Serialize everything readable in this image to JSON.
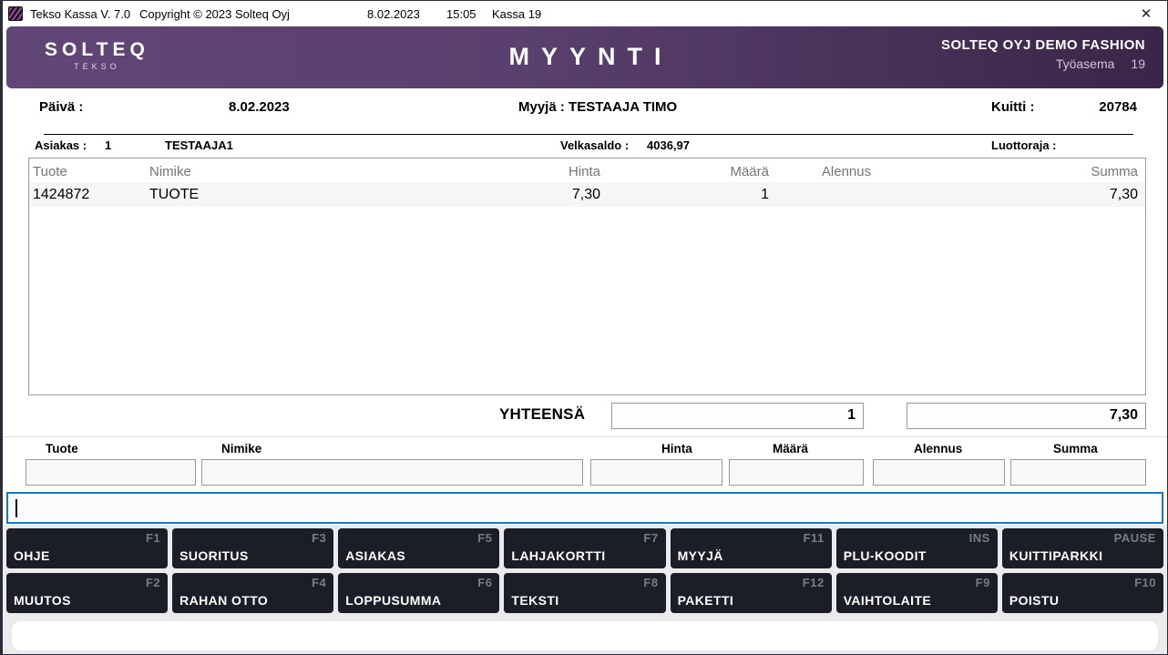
{
  "titlebar": {
    "title": "Tekso Kassa V. 7.0",
    "copyright": "Copyright © 2023 Solteq Oyj",
    "date": "8.02.2023",
    "time": "15:05",
    "register": "Kassa 19",
    "close_glyph": "✕"
  },
  "header": {
    "logo_primary": "SOLTEQ",
    "logo_secondary": "TEKSO",
    "screen_title": "MYYNTI",
    "store_name": "SOLTEQ OYJ DEMO FASHION",
    "workstation_label": "Työasema",
    "workstation_number": "19"
  },
  "receipt_info": {
    "date_label": "Päivä :",
    "date_value": "8.02.2023",
    "seller_label": "Myyjä :",
    "seller_value": "TESTAAJA TIMO",
    "receipt_label": "Kuitti :",
    "receipt_number": "20784"
  },
  "customer_info": {
    "customer_label": "Asiakas :",
    "customer_number": "1",
    "customer_name": "TESTAAJA1",
    "debt_label": "Velkasaldo :",
    "debt_value": "4036,97",
    "credit_limit_label": "Luottoraja :",
    "credit_limit_value": ""
  },
  "sale_table": {
    "columns": [
      "Tuote",
      "Nimike",
      "Hinta",
      "Määrä",
      "Alennus",
      "Summa"
    ],
    "rows": [
      {
        "tuote": "1424872",
        "nimike": "TUOTE",
        "hinta": "7,30",
        "maara": "1",
        "alennus": "",
        "summa": "7,30"
      }
    ]
  },
  "totals": {
    "label": "YHTEENSÄ",
    "total_quantity": "1",
    "total_sum": "7,30"
  },
  "entry_fields": {
    "tuote": {
      "label": "Tuote",
      "value": ""
    },
    "nimike": {
      "label": "Nimike",
      "value": ""
    },
    "hinta": {
      "label": "Hinta",
      "value": ""
    },
    "maara": {
      "label": "Määrä",
      "value": ""
    },
    "alennus": {
      "label": "Alennus",
      "value": ""
    },
    "summa": {
      "label": "Summa",
      "value": ""
    }
  },
  "command_input": {
    "value": ""
  },
  "function_keys": {
    "row1": [
      {
        "label": "OHJE",
        "key": "F1"
      },
      {
        "label": "SUORITUS",
        "key": "F3"
      },
      {
        "label": "ASIAKAS",
        "key": "F5"
      },
      {
        "label": "LAHJAKORTTI",
        "key": "F7"
      },
      {
        "label": "MYYJÄ",
        "key": "F11"
      },
      {
        "label": "PLU-KOODIT",
        "key": "INS"
      },
      {
        "label": "KUITTIPARKKI",
        "key": "PAUSE"
      }
    ],
    "row2": [
      {
        "label": "MUUTOS",
        "key": "F2"
      },
      {
        "label": "RAHAN OTTO",
        "key": "F4"
      },
      {
        "label": "LOPPUSUMMA",
        "key": "F6"
      },
      {
        "label": "TEKSTI",
        "key": "F8"
      },
      {
        "label": "PAKETTI",
        "key": "F12"
      },
      {
        "label": "VAIHTOLAITE",
        "key": "F9"
      },
      {
        "label": "POISTU",
        "key": "F10"
      }
    ]
  },
  "colors": {
    "header_gradient_start": "#614677",
    "header_gradient_end": "#3a2648",
    "button_bg": "#1b1d27",
    "button_key_text": "#787c87",
    "focus_border": "#1279cc",
    "bottom_bg": "#ebebed"
  }
}
